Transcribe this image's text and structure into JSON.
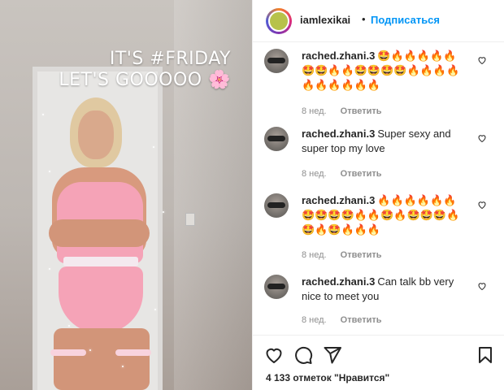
{
  "post": {
    "story_text_line1": "IT'S #FRIDAY",
    "story_text_line2": "LET'S GOOOOO 🌸"
  },
  "header": {
    "username": "iamlexikai",
    "separator": "•",
    "follow_label": "Подписаться"
  },
  "comments": [
    {
      "username": "rached.zhani.3",
      "text": "🤩🔥🔥🔥🔥🔥🤩🤩🔥🔥🤩🤩🤩🤩🔥🔥🔥🔥🔥🔥🔥🔥🔥🔥",
      "age": "8 нед.",
      "reply_label": "Ответить"
    },
    {
      "username": "rached.zhani.3",
      "text": "Super sexy and super top my love",
      "age": "8 нед.",
      "reply_label": "Ответить"
    },
    {
      "username": "rached.zhani.3",
      "text": "🔥🔥🔥🔥🔥🔥🤩🤩🤩🤩🔥🔥🤩🔥🤩🤩🤩🔥🤩🔥🤩🔥🔥🔥",
      "age": "8 нед.",
      "reply_label": "Ответить"
    },
    {
      "username": "rached.zhani.3",
      "text": "Can talk bb very nice to meet you",
      "age": "8 нед.",
      "reply_label": "Ответить"
    }
  ],
  "actions": {
    "likes_text": "4 133 отметок \"Нравится\"",
    "icons": [
      "heart-icon",
      "comment-icon",
      "share-icon",
      "bookmark-icon"
    ]
  }
}
